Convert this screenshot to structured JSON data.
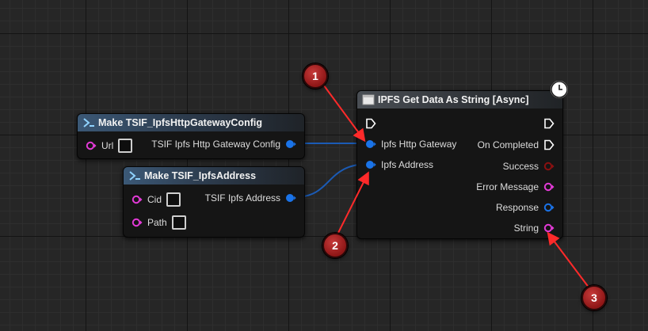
{
  "nodes": {
    "gateway_config": {
      "title": "Make TSIF_IpfsHttpGatewayConfig",
      "input_url": "Url",
      "output": "TSIF Ipfs Http Gateway Config"
    },
    "address": {
      "title": "Make TSIF_IpfsAddress",
      "input_cid": "Cid",
      "input_path": "Path",
      "output": "TSIF Ipfs Address"
    },
    "get_data": {
      "title": "IPFS Get Data As String [Async]",
      "input_gateway": "Ipfs Http Gateway",
      "input_address": "Ipfs Address",
      "out_completed": "On Completed",
      "out_success": "Success",
      "out_error": "Error Message",
      "out_response": "Response",
      "out_string": "String"
    }
  },
  "badges": [
    "1",
    "2",
    "3"
  ],
  "colors": {
    "struct_pin": "#1a73e8",
    "string_pin": "#e33ad7",
    "bool_pin": "#8a1010",
    "exec_pin": "#ffffff",
    "wire": "#1b5bb5",
    "badge": "#a81e1e"
  }
}
